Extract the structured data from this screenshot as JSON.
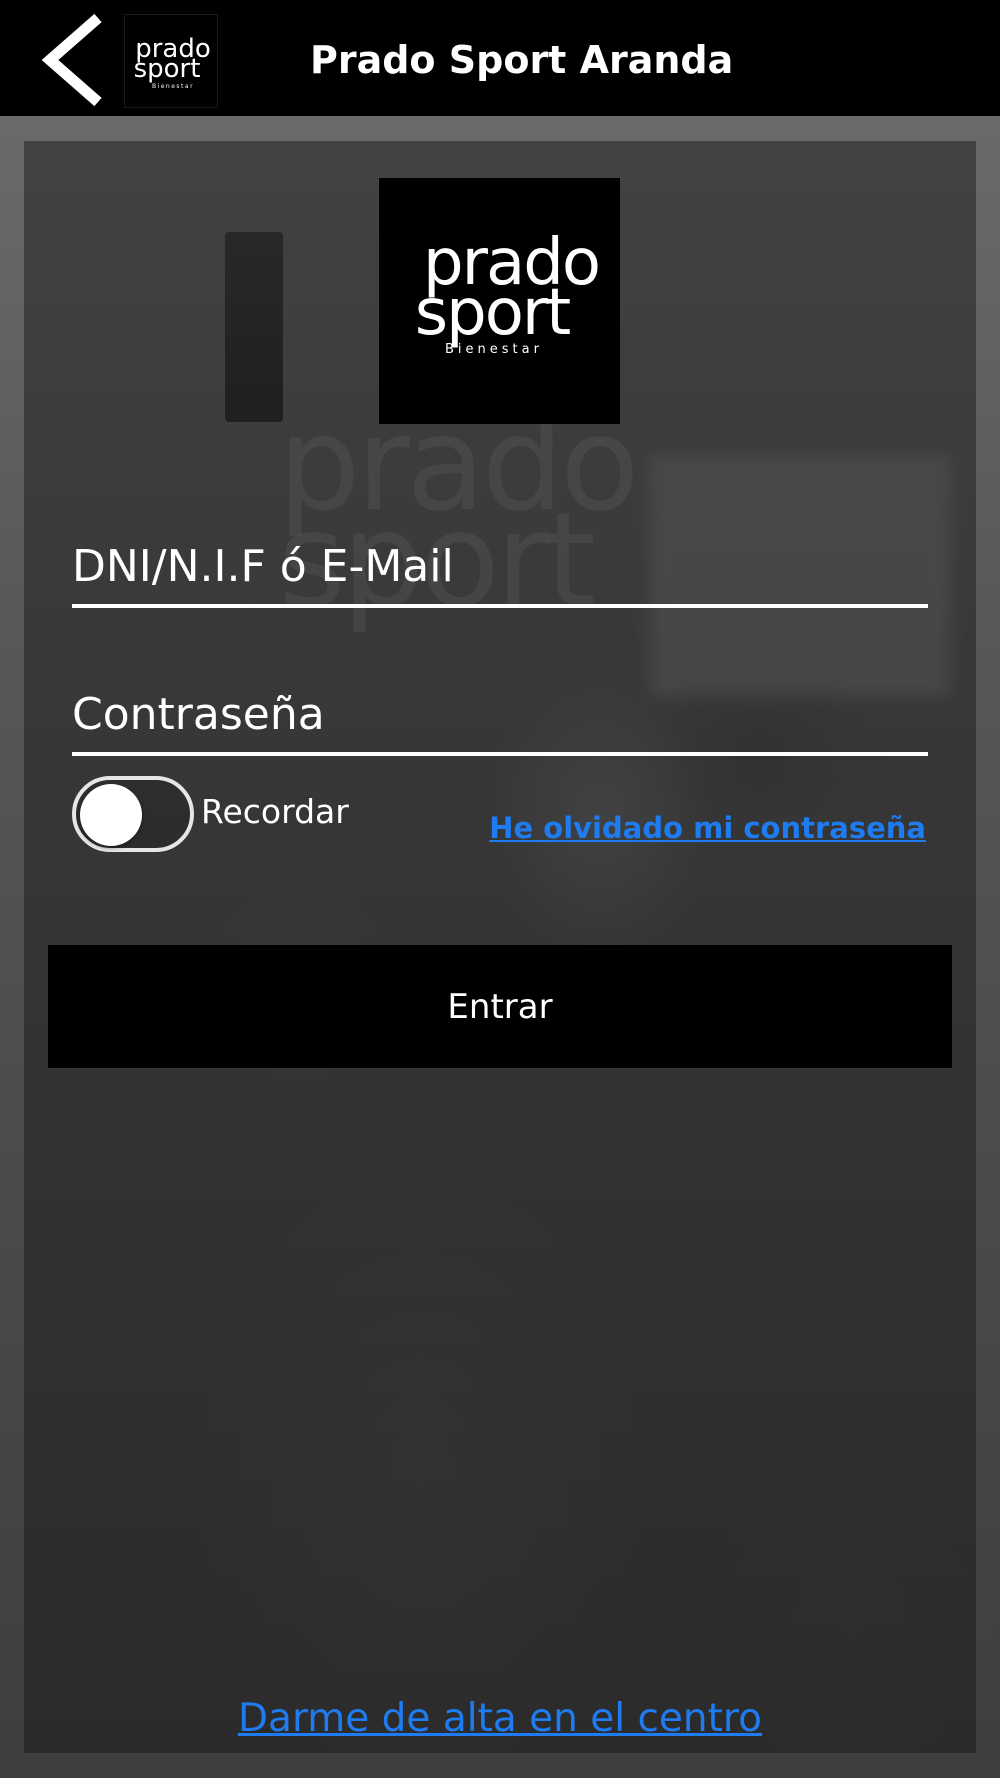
{
  "header": {
    "title": "Prado Sport Aranda",
    "back_icon": "chevron-left-icon",
    "logo": {
      "line1": "prado",
      "line2": "sport",
      "line3": "Bienestar"
    }
  },
  "brand_logo": {
    "line1": "prado",
    "line2": "sport",
    "line3": "Bienestar"
  },
  "form": {
    "username_placeholder": "DNI/N.I.F ó E-Mail",
    "password_placeholder": "Contraseña",
    "remember_label": "Recordar",
    "remember_on": false,
    "forgot_password_link": "He olvidado mi contraseña",
    "submit_label": "Entrar"
  },
  "footer": {
    "signup_link": "Darme de alta en el centro"
  },
  "colors": {
    "link": "#1e7bf0",
    "header_bg": "#000000",
    "button_bg": "#000000",
    "text": "#ffffff"
  }
}
